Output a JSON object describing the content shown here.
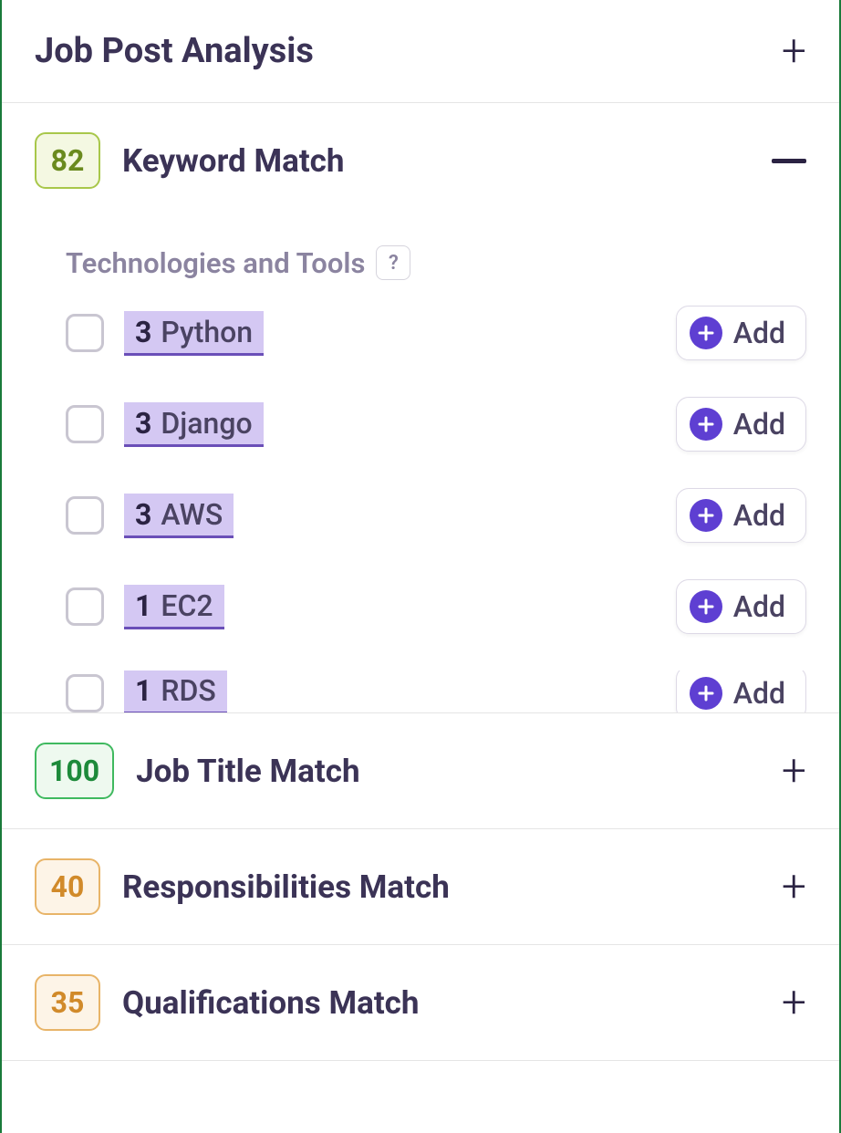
{
  "sections": {
    "jobPostAnalysis": {
      "title": "Job Post Analysis"
    },
    "keywordMatch": {
      "score": "82",
      "title": "Keyword Match",
      "category": "Technologies and Tools",
      "helpLabel": "?",
      "addLabel": "Add",
      "keywords": [
        {
          "count": "3",
          "name": "Python"
        },
        {
          "count": "3",
          "name": "Django"
        },
        {
          "count": "3",
          "name": "AWS"
        },
        {
          "count": "1",
          "name": "EC2"
        },
        {
          "count": "1",
          "name": "RDS"
        }
      ]
    },
    "jobTitleMatch": {
      "score": "100",
      "title": "Job Title Match"
    },
    "responsibilitiesMatch": {
      "score": "40",
      "title": "Responsibilities Match"
    },
    "qualificationsMatch": {
      "score": "35",
      "title": "Qualifications Match"
    }
  }
}
